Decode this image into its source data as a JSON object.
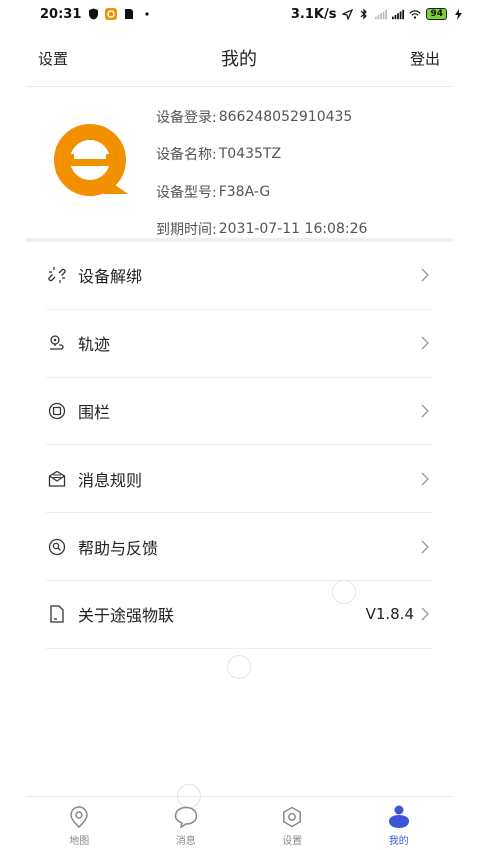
{
  "status_bar": {
    "time": "20:31",
    "network_speed": "3.1K/s",
    "battery": "94",
    "icons": [
      "shield-icon",
      "app-badge-icon",
      "sim-icon",
      "dot-icon",
      "location-icon",
      "bluetooth-icon",
      "signal-icon",
      "signal-icon",
      "wifi-icon",
      "battery-icon",
      "charging-icon"
    ]
  },
  "header": {
    "left_label": "设置",
    "title": "我的",
    "right_label": "登出"
  },
  "device": {
    "logo": "tqwl-logo",
    "brand_color": "#f39000",
    "fields": [
      {
        "key": "设备登录:",
        "value": "866248052910435"
      },
      {
        "key": "设备名称:",
        "value": "T0435TZ"
      },
      {
        "key": "设备型号:",
        "value": "F38A-G"
      },
      {
        "key": "到期时间:",
        "value": "2031-07-11 16:08:26"
      }
    ]
  },
  "menu": [
    {
      "label": "设备解绑",
      "icon": "unbind-icon",
      "value": ""
    },
    {
      "label": "轨迹",
      "icon": "track-icon",
      "value": ""
    },
    {
      "label": "围栏",
      "icon": "fence-icon",
      "value": ""
    },
    {
      "label": "消息规则",
      "icon": "message-rule-icon",
      "value": ""
    },
    {
      "label": "帮助与反馈",
      "icon": "help-icon",
      "value": ""
    },
    {
      "label": "关于途强物联",
      "icon": "document-icon",
      "value": "V1.8.4"
    }
  ],
  "tabs": [
    {
      "label": "地图",
      "icon": "map-pin-icon",
      "active": false
    },
    {
      "label": "消息",
      "icon": "chat-icon",
      "active": false
    },
    {
      "label": "设置",
      "icon": "gear-icon",
      "active": false
    },
    {
      "label": "我的",
      "icon": "user-icon",
      "active": true
    }
  ],
  "colors": {
    "accent": "#3e56d6",
    "brand": "#f39000",
    "inactive": "#888888"
  }
}
